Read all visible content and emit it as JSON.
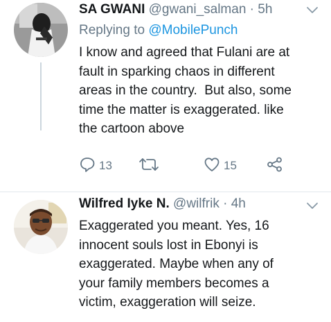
{
  "colors": {
    "text": "#14171a",
    "secondary": "#657786",
    "link": "#1b95e0",
    "divider": "#e1e8ed"
  },
  "tweets": [
    {
      "display_name": "SA GWANI",
      "handle": "@gwani_salman",
      "separator": "·",
      "timestamp": "5h",
      "reply_prefix": "Replying to",
      "reply_to": "@MobilePunch",
      "text_lines": [
        "I know and agreed that Fulani are at",
        "fault in sparking chaos in different",
        "areas in the country.  But also, some",
        "time the matter is exaggerated. like",
        "the cartoon above"
      ],
      "actions": {
        "reply_icon": "reply-icon",
        "reply_count": "13",
        "retweet_icon": "retweet-icon",
        "like_icon": "heart-icon",
        "like_count": "15",
        "share_icon": "share-icon"
      }
    },
    {
      "display_name": "Wilfred Iyke N.",
      "handle": "@wilfrik",
      "separator": "·",
      "timestamp": "4h",
      "text_lines": [
        "Exaggerated you meant. Yes, 16",
        "innocent souls lost in Ebonyi is",
        "exaggerated. Maybe when any of",
        "your family members becomes a",
        "victim, exaggeration will seize."
      ]
    }
  ]
}
